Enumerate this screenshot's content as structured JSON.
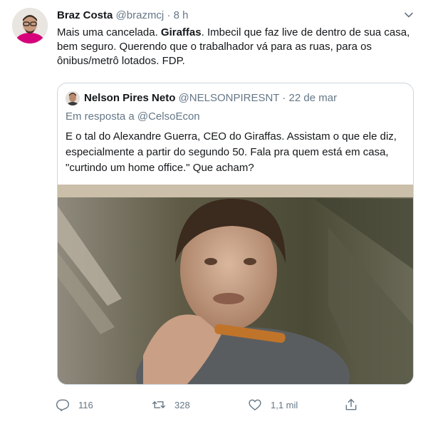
{
  "tweet": {
    "display_name": "Braz Costa",
    "handle": "@brazmcj",
    "separator": "·",
    "time": "8 h",
    "text_before": "Mais uma cancelada. ",
    "text_bold": "Giraffas",
    "text_after": ". Imbecil que faz live de dentro de sua casa, bem seguro. Querendo que o trabalhador vá para as ruas, para os ônibus/metrô lotados. FDP."
  },
  "quoted": {
    "display_name": "Nelson Pires Neto",
    "handle": "@NELSONPIRESNT",
    "separator": "·",
    "time": "22 de mar",
    "reply_to": "Em resposta a @CelsoEcon",
    "text": "E o tal do Alexandre Guerra, CEO do Giraffas. Assistam o que ele diz, especialmente a partir do segundo 50. Fala pra quem está em casa, \"curtindo um home office.\" Que acham?"
  },
  "actions": {
    "reply_count": "116",
    "retweet_count": "328",
    "like_count": "1,1 mil"
  },
  "icons": {
    "reply": "reply-icon",
    "retweet": "retweet-icon",
    "like": "like-icon",
    "share": "share-icon",
    "caret": "chevron-down-icon"
  },
  "colors": {
    "text": "#14171a",
    "secondary": "#657786",
    "border": "#ccd6dd"
  }
}
